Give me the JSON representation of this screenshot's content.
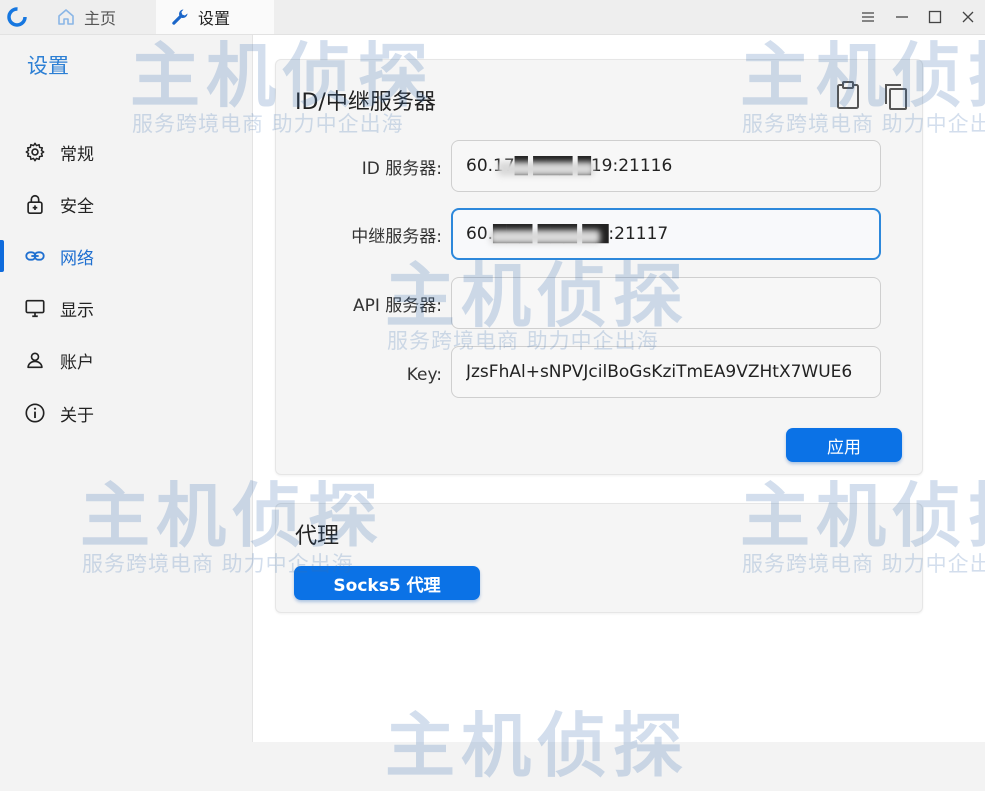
{
  "tabs": [
    {
      "label": "主页",
      "icon": "home-icon"
    },
    {
      "label": "设置",
      "icon": "wrench-icon"
    }
  ],
  "window_controls": [
    "menu-icon",
    "minimize-icon",
    "maximize-icon",
    "close-icon"
  ],
  "sidebar": {
    "title": "设置",
    "items": [
      {
        "label": "常规",
        "icon": "gear-icon"
      },
      {
        "label": "安全",
        "icon": "lock-icon"
      },
      {
        "label": "网络",
        "icon": "link-icon",
        "active": true
      },
      {
        "label": "显示",
        "icon": "monitor-icon"
      },
      {
        "label": "账户",
        "icon": "user-icon"
      },
      {
        "label": "关于",
        "icon": "info-icon"
      }
    ]
  },
  "id_server_card": {
    "title": "ID/中继服务器",
    "fields": [
      {
        "label": "ID 服务器:",
        "value": "60.17█ ███ █19:21116"
      },
      {
        "label": "中继服务器:",
        "value": "60.███ ███ ██:21117"
      },
      {
        "label": "API 服务器:",
        "value": ""
      },
      {
        "label": "Key:",
        "value": "JzsFhAl+sNPVJcilBoGsKziTmEA9VZHtX7WUE6"
      }
    ],
    "apply_label": "应用"
  },
  "proxy_card": {
    "title": "代理",
    "button_label": "Socks5 代理"
  },
  "watermark": {
    "main": "主机侦探",
    "sub": "服务跨境电商  助力中企出海"
  },
  "colors": {
    "accent": "#0b72e6",
    "active_nav": "#1e6fd0",
    "sidebar_title": "#2c7fd4"
  }
}
